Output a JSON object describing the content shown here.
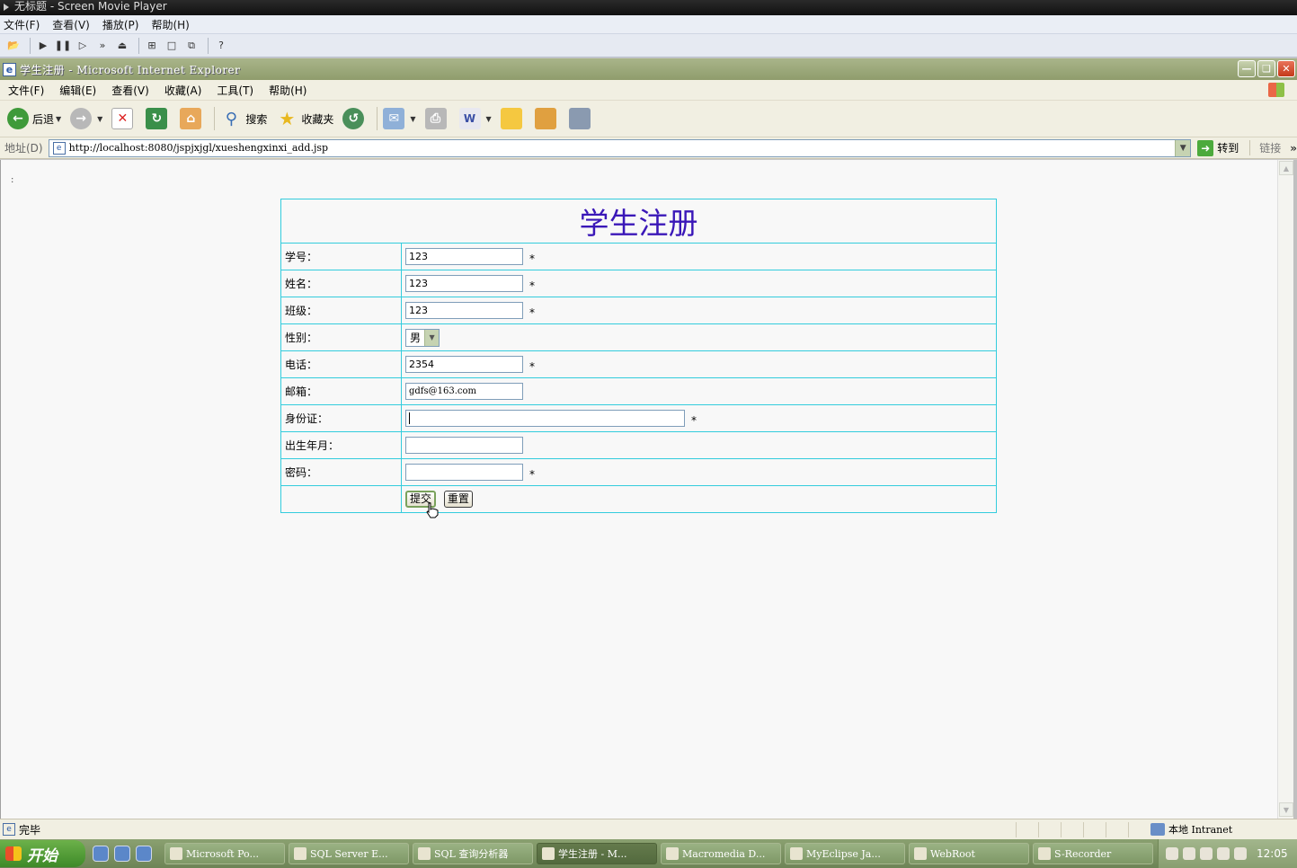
{
  "player": {
    "title": "无标题 - Screen Movie Player",
    "menu": [
      "文件(F)",
      "查看(V)",
      "播放(P)",
      "帮助(H)"
    ]
  },
  "ie": {
    "title": "学生注册 - Microsoft Internet Explorer",
    "menu": [
      "文件(F)",
      "编辑(E)",
      "查看(V)",
      "收藏(A)",
      "工具(T)",
      "帮助(H)"
    ],
    "toolbar": {
      "back": "后退",
      "search": "搜索",
      "favorites": "收藏夹"
    },
    "address": {
      "label": "地址(D)",
      "url": "http://localhost:8080/jspjxjgl/xueshengxinxi_add.jsp",
      "go": "转到",
      "links": "链接"
    },
    "status": {
      "text": "完毕",
      "zone": "本地 Intranet"
    }
  },
  "page": {
    "stray_text": ":",
    "form": {
      "title": "学生注册",
      "fields": {
        "student_no": {
          "label": "学号：",
          "value": "123"
        },
        "name": {
          "label": "姓名：",
          "value": "123"
        },
        "class": {
          "label": "班级：",
          "value": "123"
        },
        "gender": {
          "label": "性别：",
          "value": "男"
        },
        "phone": {
          "label": "电话：",
          "value": "2354"
        },
        "email": {
          "label": "邮箱：",
          "value": "gdfs@163.com"
        },
        "id_card": {
          "label": "身份证：",
          "value": ""
        },
        "birth": {
          "label": "出生年月：",
          "value": ""
        },
        "password": {
          "label": "密码：",
          "value": ""
        }
      },
      "required_mark": "*",
      "submit": "提交",
      "reset": "重置"
    }
  },
  "taskbar": {
    "start": "开始",
    "tasks": [
      "Microsoft Po...",
      "SQL Server E...",
      "SQL 查询分析器",
      "学生注册 - M...",
      "Macromedia D...",
      "MyEclipse Ja...",
      "WebRoot",
      "S-Recorder"
    ],
    "clock": "12:05"
  }
}
